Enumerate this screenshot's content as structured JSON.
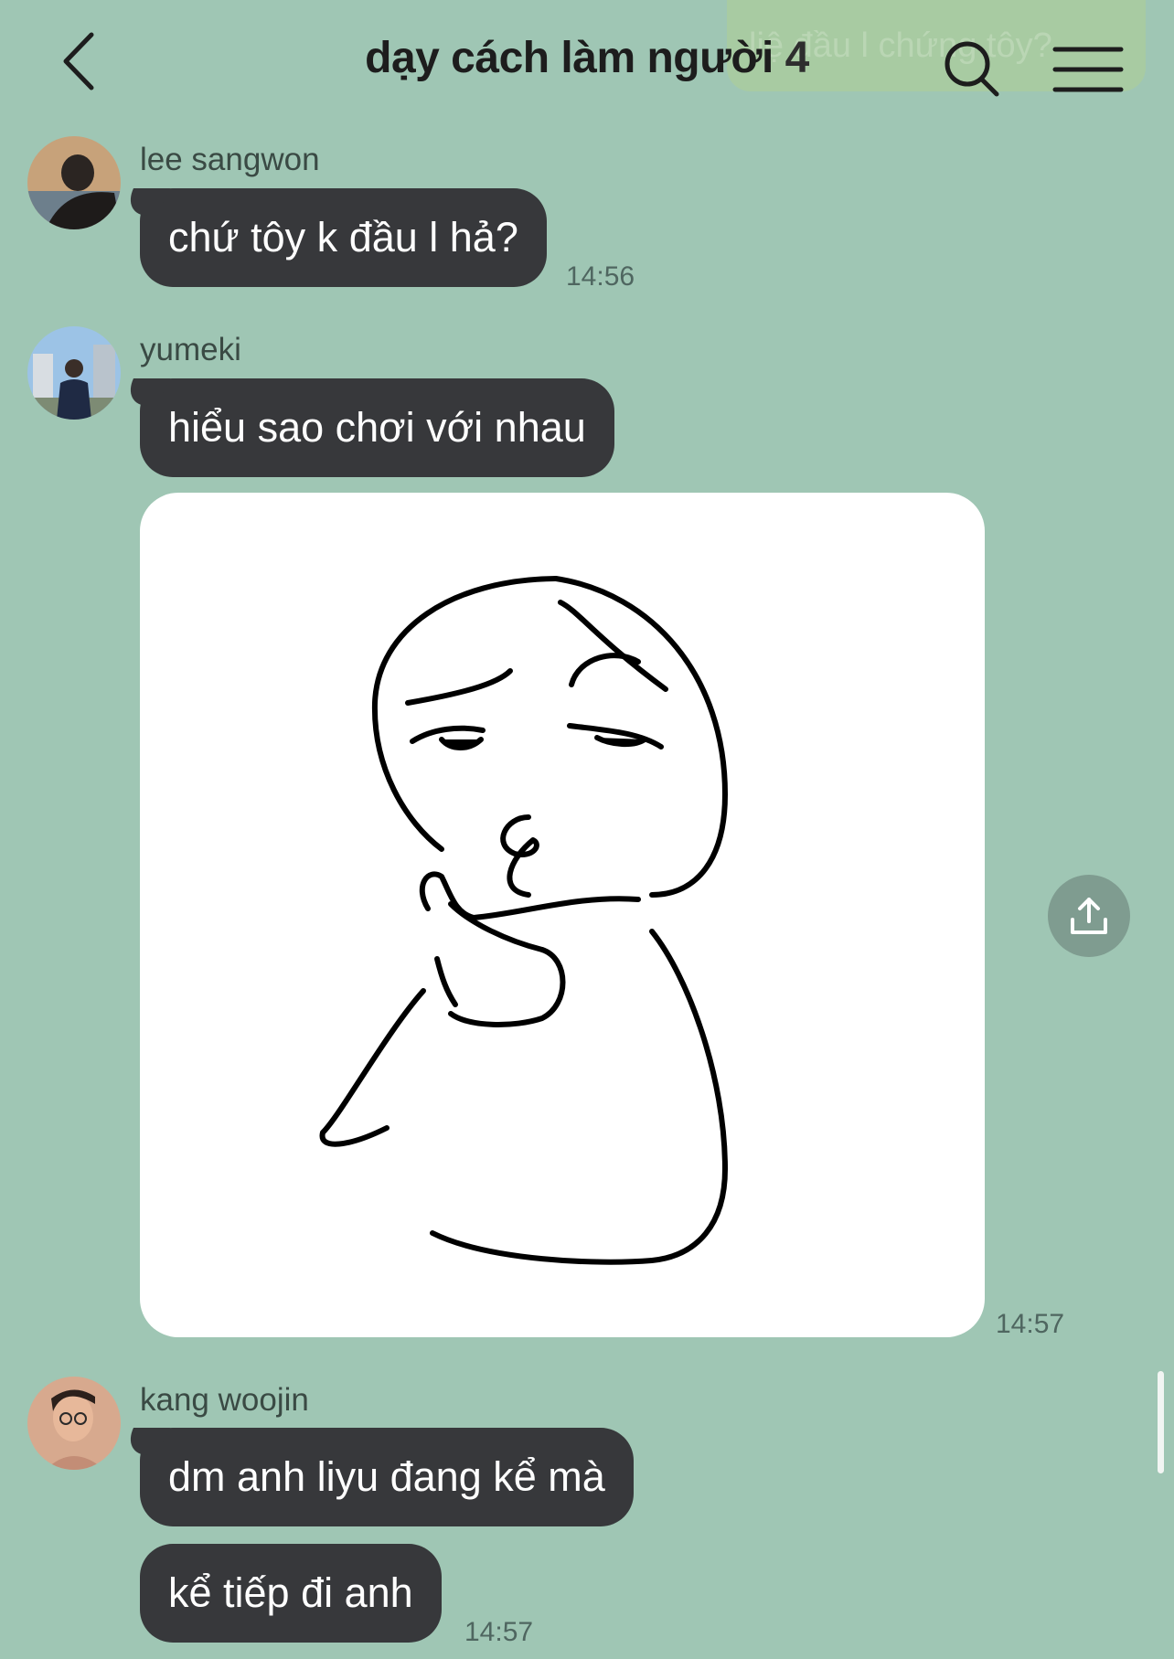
{
  "background_color": "#9fc6b4",
  "bubble_color": "#37383b",
  "ghost_banner": {
    "text": "liệ đầu l chứng tôy?"
  },
  "header": {
    "title": "dạy cách làm người",
    "member_count": "4",
    "back_icon": "chevron-left-icon",
    "search_icon": "search-icon",
    "menu_icon": "hamburger-menu-icon"
  },
  "messages": [
    {
      "sender": "lee sangwon",
      "text": "chứ tôy k đầu l hả?",
      "time": "14:56"
    },
    {
      "sender": "yumeki",
      "text": "hiểu sao chơi với nhau",
      "sticker": "thinking-face-sticker",
      "time": "14:57"
    },
    {
      "sender": "kang woojin",
      "text": "dm anh liyu đang kể mà",
      "text2": "kể tiếp đi anh",
      "time": "14:57"
    }
  ],
  "share_icon": "share-upload-icon"
}
